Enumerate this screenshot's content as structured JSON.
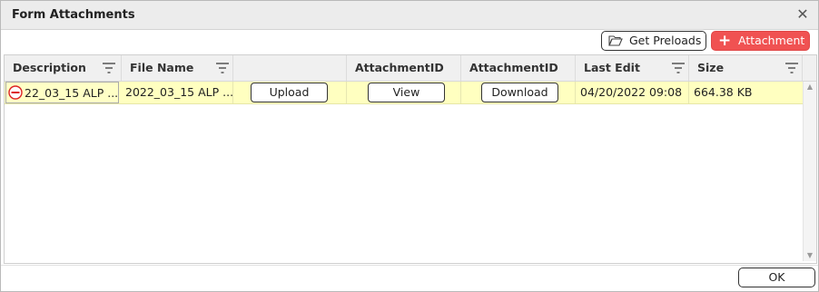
{
  "dialog": {
    "title": "Form Attachments",
    "close_glyph": "✕",
    "close_icon": "close-icon"
  },
  "toolbar": {
    "preloads_label": "Get Preloads",
    "preloads_icon": "folder-open-icon",
    "attachment_label": "Attachment",
    "attachment_icon": "plus-icon",
    "attachment_color": "#f05252"
  },
  "grid": {
    "columns": [
      {
        "label": "Description",
        "filter": true
      },
      {
        "label": "File Name",
        "filter": true
      },
      {
        "label": "",
        "filter": false
      },
      {
        "label": "AttachmentID",
        "filter": false
      },
      {
        "label": "AttachmentID",
        "filter": false
      },
      {
        "label": "Last Edit",
        "filter": true
      },
      {
        "label": "Size",
        "filter": true
      }
    ],
    "rows": [
      {
        "description": "22_03_15 ALP ...",
        "file_name": "2022_03_15 ALP ...",
        "upload_label": "Upload",
        "view_label": "View",
        "download_label": "Download",
        "last_edit": "04/20/2022 09:08",
        "size": "664.38 KB",
        "remove_icon": "remove-circle-icon",
        "highlight_color": "#ffffc0"
      }
    ]
  },
  "footer": {
    "ok_label": "OK"
  }
}
